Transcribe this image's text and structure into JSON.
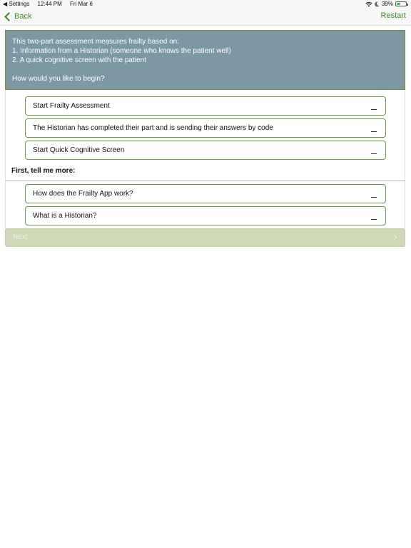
{
  "status_bar": {
    "back_app": "◀ Settings",
    "time": "12:44 PM",
    "date": "Fri Mar 6",
    "battery": "39%",
    "battery_level": 0.39
  },
  "nav": {
    "back_label": "Back",
    "restart_label": "Restart"
  },
  "intro": {
    "line1": "This two-part assessment measures frailty based on:",
    "line2": "1. Information from a Historian (someone who knows the patient well)",
    "line3": "2. A quick cognitive screen with the patient",
    "question": "How would you like to begin?"
  },
  "options": [
    "Start Frailty Assessment",
    "The Historian has completed their part and is sending their answers by code",
    "Start Quick Cognitive Screen"
  ],
  "more": {
    "title": "First, tell me more:",
    "items": [
      "How does the Frailty App work?",
      "What is a Historian?"
    ]
  },
  "next_label": "Next",
  "colors": {
    "accent": "#3e8a1e",
    "panel": "#7d97a3",
    "option_border": "#6a9a47",
    "next_disabled": "#cfd8b7"
  }
}
